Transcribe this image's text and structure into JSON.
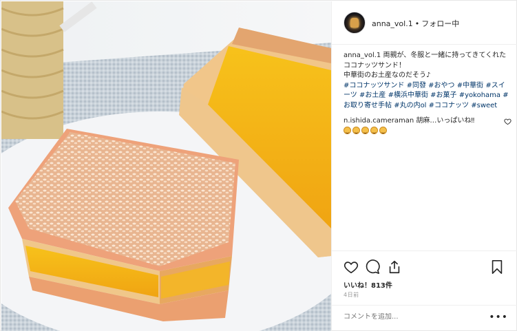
{
  "post": {
    "username": "anna_vol.1",
    "separator": "•",
    "follow_status": "フォロー中",
    "caption": {
      "user": "anna_vol.1",
      "line1": " 両親が、冬服と一緒に持ってきてくれたココナッツサンド！",
      "line2": "中華街のお土産なのだそう♪",
      "hashtags": [
        "#ココナッツサンド",
        "#同發",
        "#おやつ",
        "#中華街",
        "#スイーツ",
        "#お土産",
        "#横浜中華街",
        "#お菓子",
        "#yokohama",
        "#お取り寄せ手帖",
        "#丸の内ol",
        "#ココナッツ",
        "#sweet"
      ]
    },
    "comment": {
      "user": "n.ishida.cameraman",
      "text": " 胡麻…いっぱいね‼",
      "emoji_count": 5
    },
    "likes_text": "いいね！813件",
    "date_text": "4日前",
    "add_comment_placeholder": "コメントを追加...",
    "more_label": "•••"
  },
  "icons": {
    "like": "heart-icon",
    "comment": "comment-bubble-icon",
    "share": "share-icon",
    "save": "bookmark-icon",
    "comment_like": "heart-icon"
  },
  "colors": {
    "hashtag": "#003569",
    "text": "#262626",
    "muted": "#999999",
    "border": "#efefef"
  }
}
